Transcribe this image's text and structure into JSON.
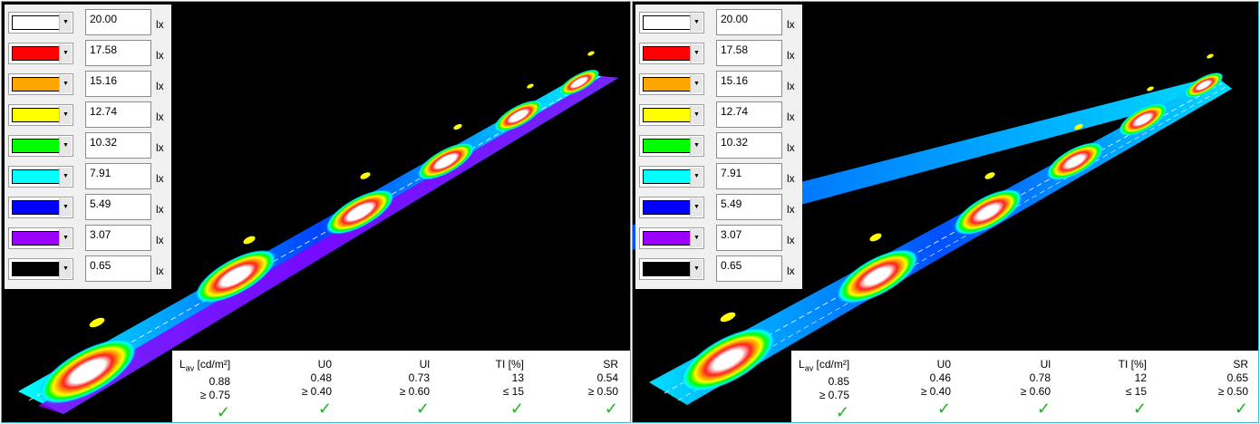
{
  "legend": [
    {
      "value": "20.00",
      "unit": "lx",
      "color": "#ffffff"
    },
    {
      "value": "17.58",
      "unit": "lx",
      "color": "#ff0000"
    },
    {
      "value": "15.16",
      "unit": "lx",
      "color": "#ffa500"
    },
    {
      "value": "12.74",
      "unit": "lx",
      "color": "#ffff00"
    },
    {
      "value": "10.32",
      "unit": "lx",
      "color": "#00ff00"
    },
    {
      "value": "7.91",
      "unit": "lx",
      "color": "#00ffff"
    },
    {
      "value": "5.49",
      "unit": "lx",
      "color": "#0000ff"
    },
    {
      "value": "3.07",
      "unit": "lx",
      "color": "#9900ff"
    },
    {
      "value": "0.65",
      "unit": "lx",
      "color": "#000000"
    }
  ],
  "headers": {
    "lav_main": "L",
    "lav_sub": "av",
    "lav_unit": " [cd/m²]",
    "u0": "U0",
    "ul": "Ul",
    "ti": "TI [%]",
    "sr": "SR"
  },
  "left": {
    "lav": {
      "value": "0.88",
      "req": "≥ 0.75"
    },
    "u0": {
      "value": "0.48",
      "req": "≥ 0.40"
    },
    "ul": {
      "value": "0.73",
      "req": "≥ 0.60"
    },
    "ti": {
      "value": "13",
      "req": "≤ 15"
    },
    "sr": {
      "value": "0.54",
      "req": "≥ 0.50"
    }
  },
  "right": {
    "lav": {
      "value": "0.85",
      "req": "≥ 0.75"
    },
    "u0": {
      "value": "0.46",
      "req": "≥ 0.40"
    },
    "ul": {
      "value": "0.78",
      "req": "≥ 0.60"
    },
    "ti": {
      "value": "12",
      "req": "≤ 15"
    },
    "sr": {
      "value": "0.65",
      "req": "≥ 0.50"
    }
  },
  "check_icon": "check-icon",
  "check_color": "#22b022",
  "panel_border_color": "#3cb8d8"
}
